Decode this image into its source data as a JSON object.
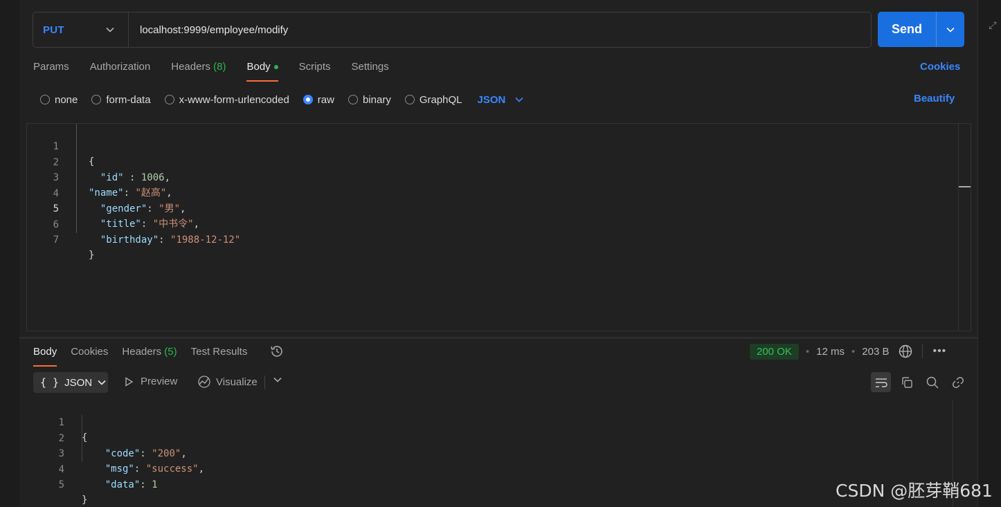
{
  "request": {
    "method": "PUT",
    "url": "localhost:9999/employee/modify",
    "send_label": "Send"
  },
  "request_tabs": [
    {
      "label": "Params"
    },
    {
      "label": "Authorization"
    },
    {
      "label": "Headers",
      "count": "(8)"
    },
    {
      "label": "Body",
      "active": true
    },
    {
      "label": "Scripts"
    },
    {
      "label": "Settings"
    }
  ],
  "cookies_label": "Cookies",
  "body_types": [
    {
      "label": "none"
    },
    {
      "label": "form-data"
    },
    {
      "label": "x-www-form-urlencoded"
    },
    {
      "label": "raw",
      "checked": true
    },
    {
      "label": "binary"
    },
    {
      "label": "GraphQL"
    }
  ],
  "raw_language": "JSON",
  "beautify_label": "Beautify",
  "request_body": {
    "line_numbers": [
      "1",
      "2",
      "3",
      "4",
      "5",
      "6",
      "7"
    ],
    "brace_open": "{",
    "brace_close": "}",
    "id_key": "\"id\"",
    "id_val": "1006",
    "name_key": "\"name\"",
    "name_val": "\"赵高\"",
    "gender_key": "\"gender\"",
    "gender_val": "\"男\"",
    "title_key": "\"title\"",
    "title_val": "\"中书令\"",
    "birthday_key": "\"birthday\"",
    "birthday_val": "\"1988-12-12\""
  },
  "response_tabs": [
    {
      "label": "Body",
      "active": true
    },
    {
      "label": "Cookies"
    },
    {
      "label": "Headers",
      "count": "(5)"
    },
    {
      "label": "Test Results"
    }
  ],
  "response_meta": {
    "status": "200 OK",
    "time": "12 ms",
    "size": "203 B"
  },
  "response_format": "JSON",
  "response_format_braces": "{ }",
  "preview_label": "Preview",
  "visualize_label": "Visualize",
  "response_body": {
    "line_numbers": [
      "1",
      "2",
      "3",
      "4",
      "5"
    ],
    "brace_open": "{",
    "brace_close": "}",
    "code_key": "\"code\"",
    "code_val": "\"200\"",
    "msg_key": "\"msg\"",
    "msg_val": "\"success\"",
    "data_key": "\"data\"",
    "data_val": "1"
  },
  "watermark": "CSDN @胚芽鞘681",
  "colors": {
    "accent_blue": "#3b86ff",
    "send_blue": "#1a6fe0",
    "active_tab_underline": "#ff6c37",
    "success_green": "#35c25a",
    "background": "#212121"
  }
}
